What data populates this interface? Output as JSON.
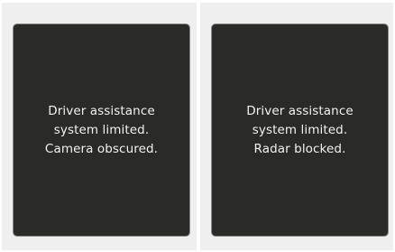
{
  "displays": [
    {
      "message_lines": [
        "Driver assistance",
        "system limited.",
        "Camera obscured."
      ]
    },
    {
      "message_lines": [
        "Driver assistance",
        "system limited.",
        "Radar blocked."
      ]
    }
  ],
  "colors": {
    "panel_background": "#efefef",
    "screen_background": "#2a2a28",
    "screen_border": "#8a8a88",
    "text": "#f2f2f2"
  }
}
